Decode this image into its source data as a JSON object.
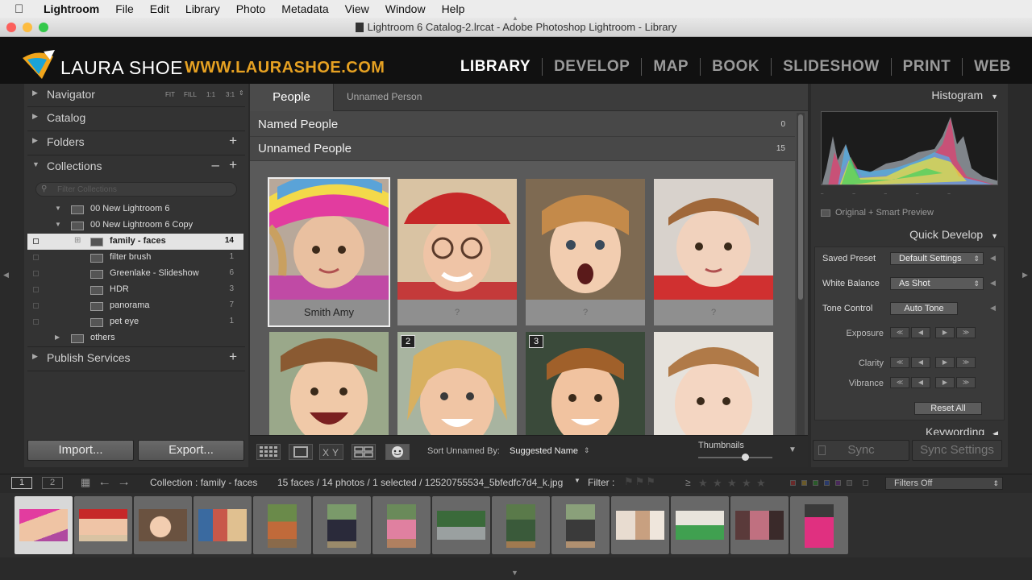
{
  "menubar": {
    "app": "Lightroom",
    "items": [
      "File",
      "Edit",
      "Library",
      "Photo",
      "Metadata",
      "View",
      "Window",
      "Help"
    ]
  },
  "window": {
    "title": "Lightroom 6 Catalog-2.lrcat - Adobe Photoshop Lightroom - Library"
  },
  "identity": {
    "brand": "LAURA SHOE",
    "site": "WWW.LAURASHOE.COM",
    "modules": [
      "LIBRARY",
      "DEVELOP",
      "MAP",
      "BOOK",
      "SLIDESHOW",
      "PRINT",
      "WEB"
    ],
    "active_module": "LIBRARY"
  },
  "left_panel": {
    "navigator": {
      "label": "Navigator",
      "zoom": [
        "FIT",
        "FILL",
        "1:1",
        "3:1"
      ]
    },
    "catalog": {
      "label": "Catalog"
    },
    "folders": {
      "label": "Folders"
    },
    "collections": {
      "label": "Collections",
      "filter_placeholder": "Filter Collections",
      "rows": [
        {
          "name": "00 New Lightroom 6",
          "count": ""
        },
        {
          "name": "00 New Lightroom 6 Copy",
          "count": ""
        },
        {
          "name": "family - faces",
          "count": "14"
        },
        {
          "name": "filter brush",
          "count": "1"
        },
        {
          "name": "Greenlake - Slideshow",
          "count": "6"
        },
        {
          "name": "HDR",
          "count": "3"
        },
        {
          "name": "panorama",
          "count": "7"
        },
        {
          "name": "pet eye",
          "count": "1"
        },
        {
          "name": "others",
          "count": ""
        }
      ]
    },
    "publish": {
      "label": "Publish Services"
    },
    "import_label": "Import...",
    "export_label": "Export..."
  },
  "center": {
    "tab_people": "People",
    "tab_unnamed": "Unnamed Person",
    "named_label": "Named People",
    "named_count": "0",
    "unnamed_label": "Unnamed People",
    "unnamed_count": "15",
    "cells": [
      {
        "caption": "Smith Amy",
        "badge": ""
      },
      {
        "caption": "?",
        "badge": ""
      },
      {
        "caption": "?",
        "badge": ""
      },
      {
        "caption": "?",
        "badge": ""
      },
      {
        "caption": "",
        "badge": ""
      },
      {
        "caption": "",
        "badge": "2"
      },
      {
        "caption": "",
        "badge": "3"
      },
      {
        "caption": "",
        "badge": ""
      }
    ],
    "sort_label": "Sort Unnamed By:",
    "sort_value": "Suggested Name",
    "thumbnails_label": "Thumbnails"
  },
  "right_panel": {
    "histogram": "Histogram",
    "preview_label": "Original + Smart Preview",
    "quick_develop": "Quick Develop",
    "saved_preset_label": "Saved Preset",
    "saved_preset_value": "Default Settings",
    "white_balance_label": "White Balance",
    "white_balance_value": "As Shot",
    "tone_control_label": "Tone Control",
    "auto_tone": "Auto Tone",
    "exposure": "Exposure",
    "clarity": "Clarity",
    "vibrance": "Vibrance",
    "reset_all": "Reset All",
    "keywording": "Keywording",
    "sync": "Sync",
    "sync_settings": "Sync Settings"
  },
  "filterbar": {
    "page1": "1",
    "page2": "2",
    "source": "Collection : family - faces",
    "info": "15 faces / 14 photos / 1 selected / 12520755534_5bfedfc7d4_k.jpg",
    "filter_label": "Filter :",
    "filters_off": "Filters Off"
  }
}
